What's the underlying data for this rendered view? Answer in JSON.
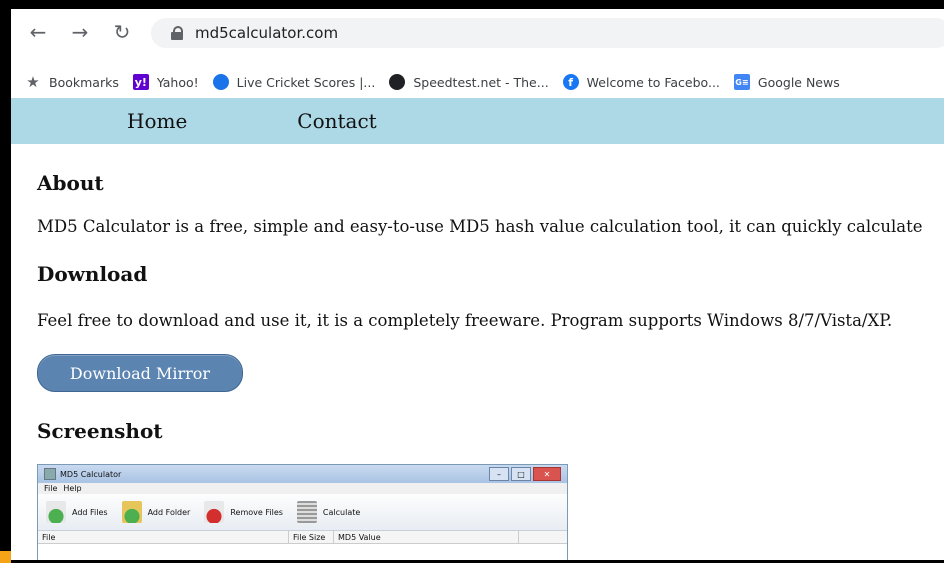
{
  "browser": {
    "url": "md5calculator.com",
    "nav_icons": [
      "back-arrow-icon",
      "forward-arrow-icon",
      "reload-icon"
    ],
    "bookmarks": [
      {
        "label": "Bookmarks",
        "icon": "star-icon"
      },
      {
        "label": "Yahoo!",
        "icon": "yahoo-icon",
        "icon_text": "y!"
      },
      {
        "label": "Live Cricket Scores |...",
        "icon": "cricket-icon"
      },
      {
        "label": "Speedtest.net - The...",
        "icon": "speedtest-icon"
      },
      {
        "label": "Welcome to Facebo...",
        "icon": "facebook-icon",
        "icon_text": "f"
      },
      {
        "label": "Google News",
        "icon": "google-news-icon",
        "icon_text": "G≡"
      }
    ]
  },
  "site_nav": {
    "home": "Home",
    "contact": "Contact"
  },
  "page": {
    "about_heading": "About",
    "about_text": "MD5 Calculator is a free, simple and easy-to-use MD5 hash value calculation tool, it can quickly calculate",
    "download_heading": "Download",
    "download_text": "Feel free to download and use it, it is a completely freeware. Program supports Windows 8/7/Vista/XP.",
    "download_button": "Download Mirror",
    "screenshot_heading": "Screenshot"
  },
  "screenshot": {
    "window_title": "MD5 Calculator",
    "menu": [
      "File",
      "Help"
    ],
    "toolbar": [
      "Add Files",
      "Add Folder",
      "Remove Files",
      "Calculate"
    ],
    "columns": [
      "File",
      "File Size",
      "MD5 Value"
    ]
  },
  "colors": {
    "nav_bar": "#add8e6",
    "button": "#5b84b1"
  }
}
